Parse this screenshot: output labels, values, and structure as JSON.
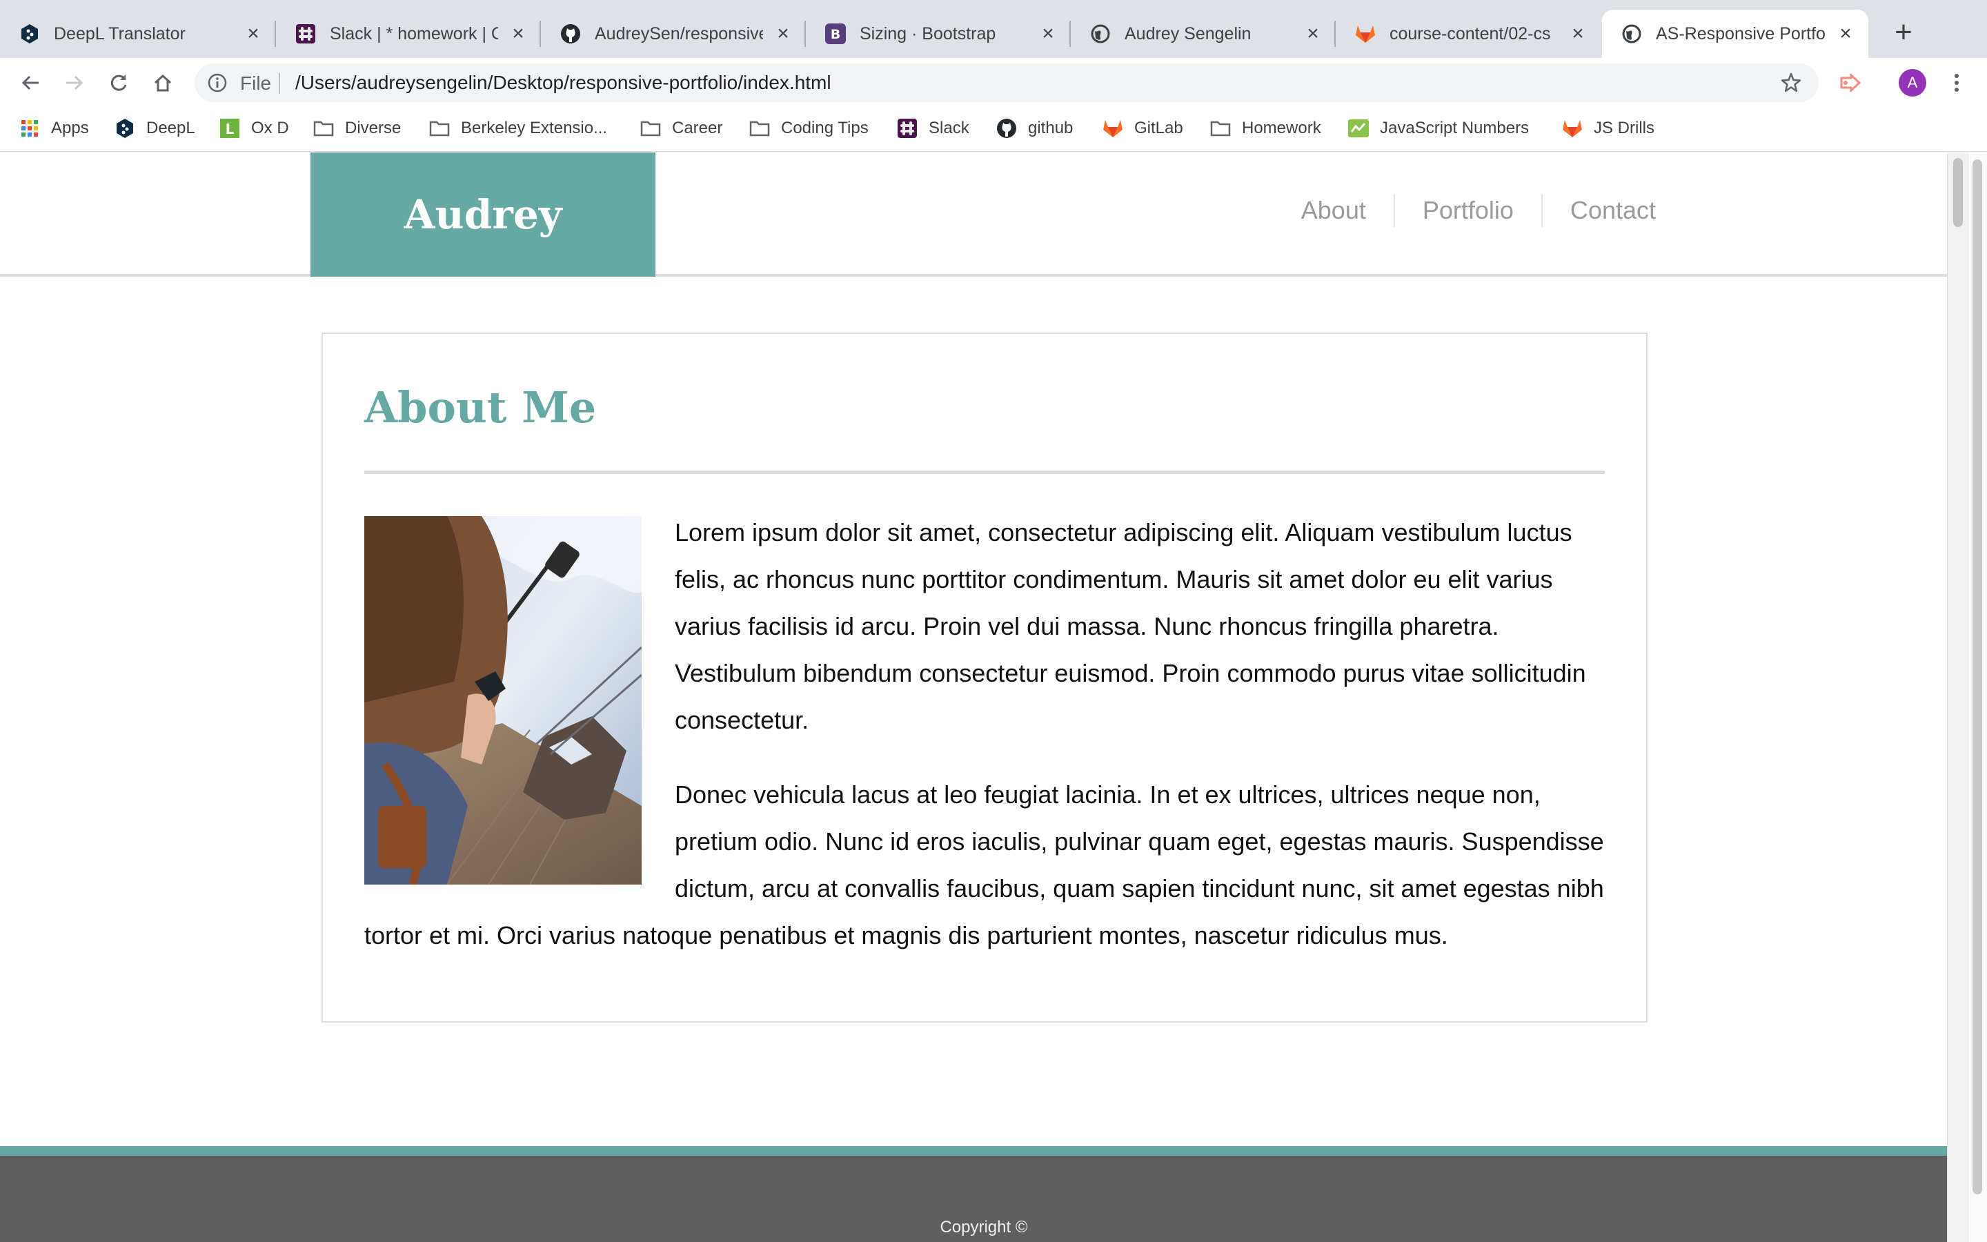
{
  "browser": {
    "tabs": [
      {
        "title": "DeepL Translator",
        "icon": "deepl-icon"
      },
      {
        "title": "Slack | * homework | C",
        "icon": "slack-icon"
      },
      {
        "title": "AudreySen/responsive",
        "icon": "github-icon"
      },
      {
        "title": "Sizing · Bootstrap",
        "icon": "bootstrap-icon"
      },
      {
        "title": "Audrey Sengelin",
        "icon": "globe-icon"
      },
      {
        "title": "course-content/02-cs",
        "icon": "gitlab-icon"
      },
      {
        "title": "AS-Responsive Portfol",
        "icon": "globe-icon",
        "active": true
      }
    ],
    "address": {
      "scheme": "File",
      "url": "/Users/audreysengelin/Desktop/responsive-portfolio/index.html"
    },
    "profile_initial": "A",
    "bookmarks": [
      {
        "label": "Apps",
        "icon": "apps-grid-icon"
      },
      {
        "label": "DeepL",
        "icon": "deepl-icon"
      },
      {
        "label": "Ox D",
        "icon": "oxd-icon"
      },
      {
        "label": "Diverse",
        "icon": "folder-icon"
      },
      {
        "label": "Berkeley Extensio...",
        "icon": "folder-icon"
      },
      {
        "label": "Career",
        "icon": "folder-icon"
      },
      {
        "label": "Coding Tips",
        "icon": "folder-icon"
      },
      {
        "label": "Slack",
        "icon": "slack-icon"
      },
      {
        "label": "github",
        "icon": "github-icon"
      },
      {
        "label": "GitLab",
        "icon": "gitlab-icon"
      },
      {
        "label": "Homework",
        "icon": "folder-icon"
      },
      {
        "label": "JavaScript Numbers",
        "icon": "js-icon"
      },
      {
        "label": "JS Drills",
        "icon": "gitlab-icon"
      }
    ]
  },
  "site": {
    "brand": "Audrey",
    "nav": [
      "About",
      "Portfolio",
      "Contact"
    ],
    "section_title": "About Me",
    "paragraphs": [
      "Lorem ipsum dolor sit amet, consectetur adipiscing elit. Aliquam vestibulum luctus felis, ac rhoncus nunc porttitor condimentum. Mauris sit amet dolor eu elit varius varius facilisis id arcu. Proin vel dui massa. Nunc rhoncus fringilla pharetra. Vestibulum bibendum consectetur euismod. Proin commodo purus vitae sollicitudin consectetur.",
      "Donec vehicula lacus at leo feugiat lacinia. In et ex ultrices, ultrices neque non, pretium odio. Nunc id eros iaculis, pulvinar quam eget, egestas mauris. Suspendisse dictum, arcu at convallis faucibus, quam sapien tincidunt nunc, sit amet egestas nibh tortor et mi. Orci varius natoque penatibus et magnis dis parturient montes, nascetur ridiculus mus."
    ],
    "copyright": "Copyright ©",
    "colors": {
      "accent": "#66a8a3",
      "footer": "#5f5f60",
      "nav_text": "#9a9a9a"
    }
  }
}
